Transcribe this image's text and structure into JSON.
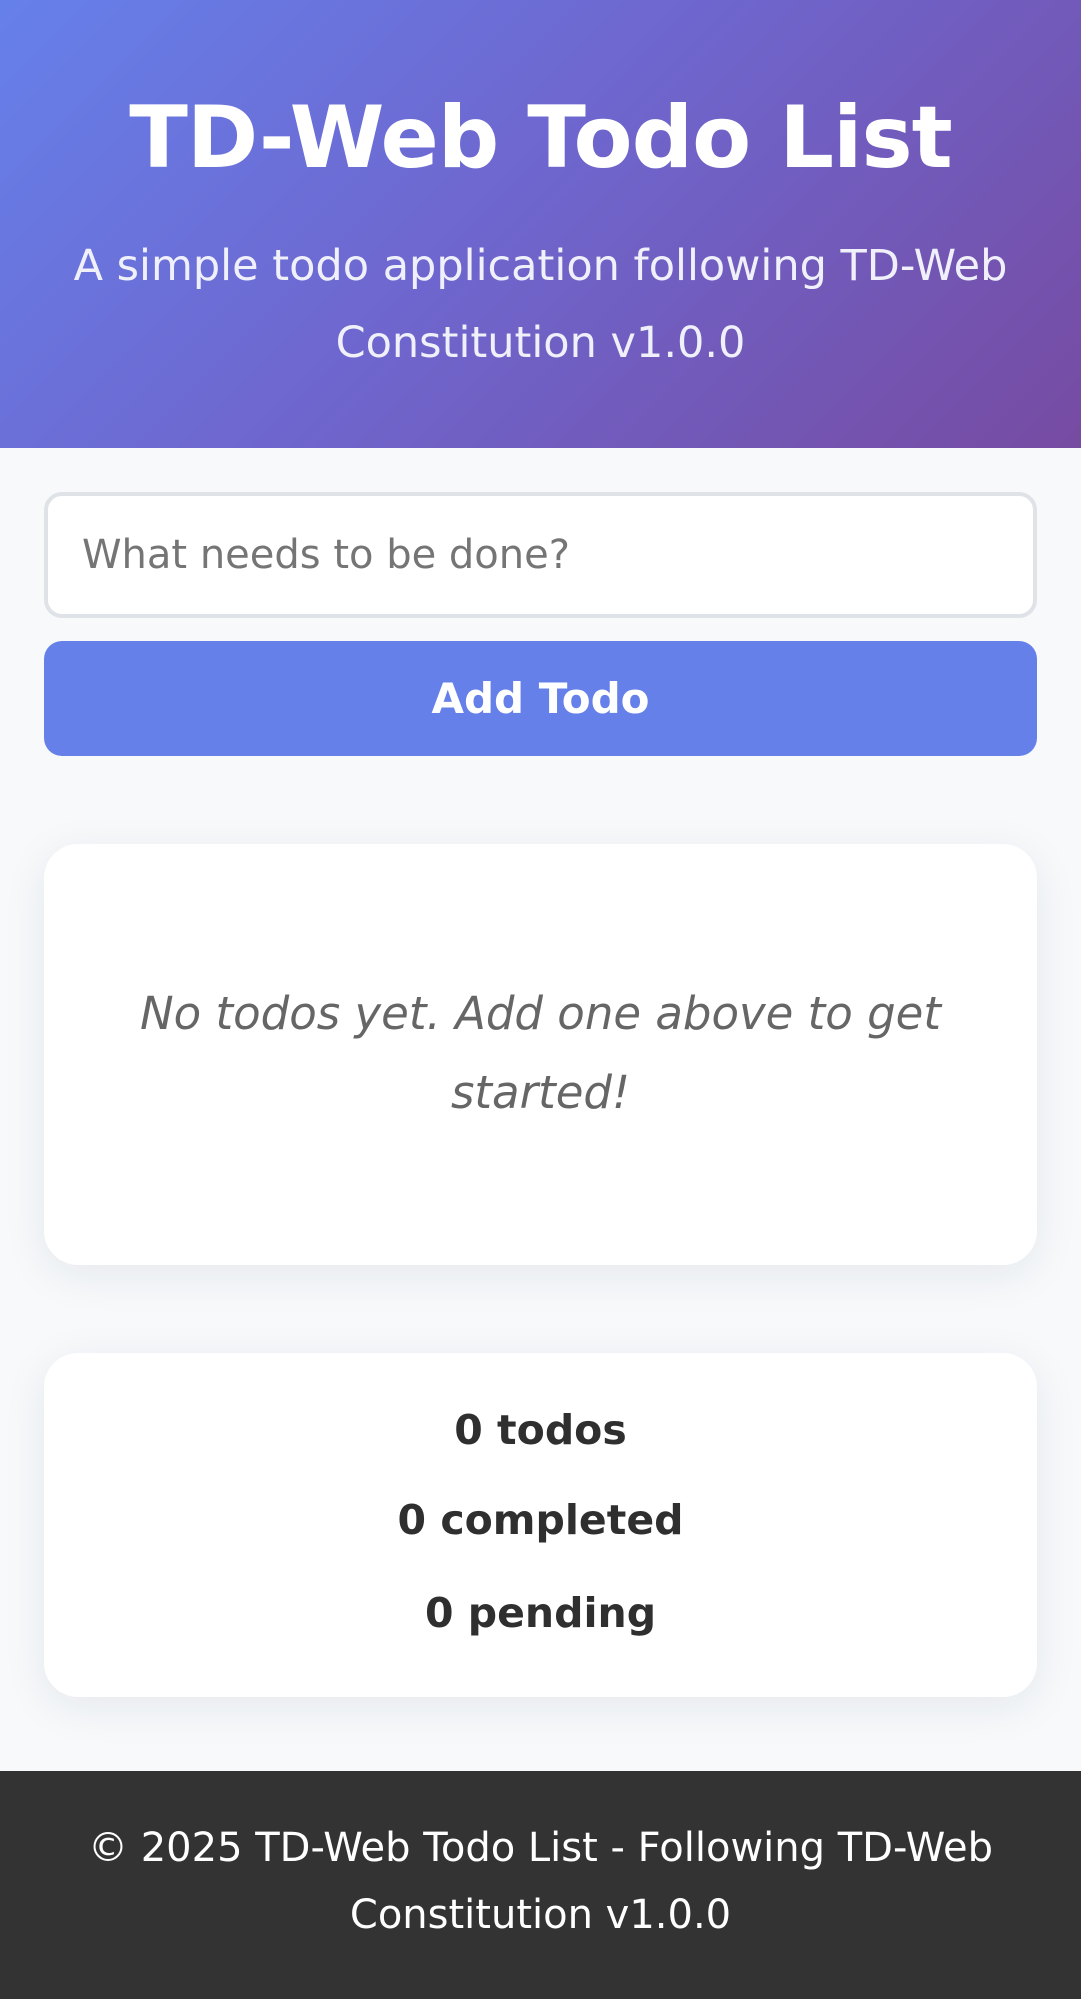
{
  "header": {
    "title": "TD-Web Todo List",
    "subtitle": "A simple todo application following TD-Web Constitution v1.0.0"
  },
  "form": {
    "input_placeholder": "What needs to be done?",
    "input_value": "",
    "add_button_label": "Add Todo"
  },
  "todo_list": {
    "empty_message": "No todos yet. Add one above to get started!"
  },
  "stats": {
    "total": "0 todos",
    "completed": "0 completed",
    "pending": "0 pending"
  },
  "footer": {
    "text": "© 2025 TD-Web Todo List - Following TD-Web Constitution v1.0.0"
  },
  "colors": {
    "gradient_start": "#6680ea",
    "gradient_end": "#764ba2",
    "button": "#6680ea",
    "footer_bg": "#333333",
    "page_bg": "#f7f9fb"
  }
}
